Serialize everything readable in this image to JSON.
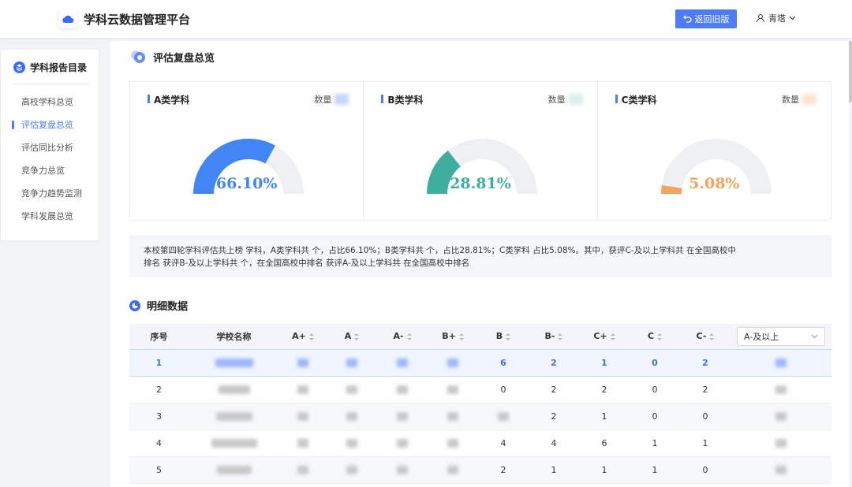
{
  "header": {
    "app_title": "学科云数据管理平台",
    "back_button": "返回旧版",
    "user_name": "青塔"
  },
  "sidebar": {
    "title": "学科报告目录",
    "items": [
      {
        "label": "高校学科总览",
        "active": false
      },
      {
        "label": "评估复盘总览",
        "active": true
      },
      {
        "label": "评估同比分析",
        "active": false
      },
      {
        "label": "竞争力总览",
        "active": false
      },
      {
        "label": "竞争力趋势监测",
        "active": false
      },
      {
        "label": "学科发展总览",
        "active": false
      }
    ]
  },
  "overview": {
    "title": "评估复盘总览",
    "cards": [
      {
        "title": "A类学科",
        "count_label": "数量",
        "value": 66.1,
        "value_text": "66.10%",
        "color": "#4285f4"
      },
      {
        "title": "B类学科",
        "count_label": "数量",
        "value": 28.81,
        "value_text": "28.81%",
        "color": "#3fae9e"
      },
      {
        "title": "C类学科",
        "count_label": "数量",
        "value": 5.08,
        "value_text": "5.08%",
        "color": "#f5a35c"
      }
    ],
    "summary_line1": "本校第四轮学科评估共上榜         学科，A类学科共     个，占比66.10%；B类学科共     个，占比28.81%；C类学科           占比5.08%。其中，获评C-及以上学科共            在全国高校中",
    "summary_line2": "排名            获评B-及以上学科共     个，在全国高校中排名             获评A-及以上学科共            在全国高校中排名"
  },
  "detail": {
    "title": "明细数据",
    "columns": [
      "序号",
      "学校名称",
      "A+",
      "A",
      "A-",
      "B+",
      "B",
      "B-",
      "C+",
      "C",
      "C-"
    ],
    "filter_value": "A-及以上",
    "rows": [
      {
        "index": "1",
        "B": "6",
        "B-": "2",
        "C+": "1",
        "C": "0",
        "C-": "2"
      },
      {
        "index": "2",
        "B": "0",
        "B-": "2",
        "C+": "2",
        "C": "0",
        "C-": "2"
      },
      {
        "index": "3",
        "B": "",
        "B-": "2",
        "C+": "1",
        "C": "0",
        "C-": "0"
      },
      {
        "index": "4",
        "B": "4",
        "B-": "4",
        "C+": "6",
        "C": "1",
        "C-": "1"
      },
      {
        "index": "5",
        "B": "2",
        "B-": "1",
        "C+": "1",
        "C": "1",
        "C-": "0"
      }
    ]
  },
  "icons": {
    "logo": "cloud-icon",
    "back": "return-arrow-icon",
    "user": "user-icon",
    "dropdown": "chevron-down-icon",
    "sidebar_title": "layers-icon",
    "overview": "circle-dots-icon",
    "detail": "circle-chart-icon",
    "sort": "sort-icon"
  },
  "colors": {
    "accent": "#4e7bf7"
  }
}
